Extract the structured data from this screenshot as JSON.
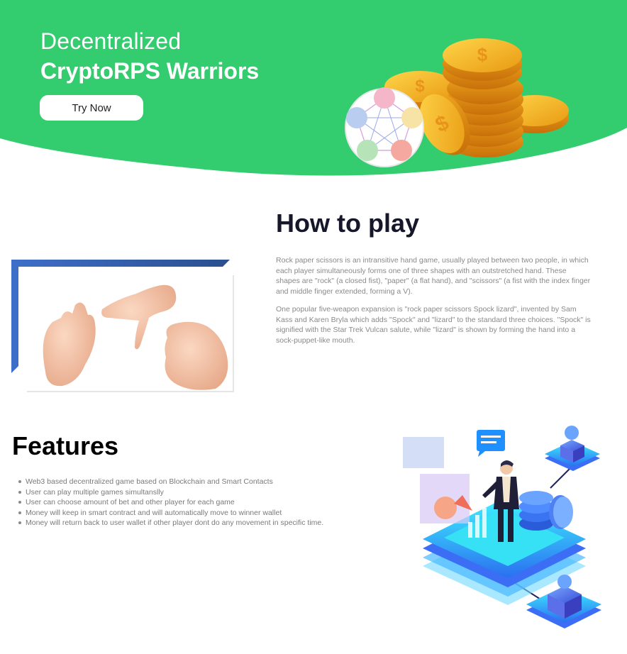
{
  "hero": {
    "subtitle": "Decentralized",
    "title": "CryptoRPS Warriors",
    "cta_label": "Try Now",
    "bg_color": "#33cc6f"
  },
  "how_to_play": {
    "title": "How to play",
    "paragraphs": [
      "Rock paper scissors is an intransitive hand game, usually played between two people, in which each player simultaneously forms one of three shapes with an outstretched hand. These shapes are \"rock\" (a closed fist), \"paper\" (a flat hand), and \"scissors\" (a fist with the index finger and middle finger extended, forming a V).",
      "One popular five-weapon expansion is \"rock paper scissors Spock lizard\", invented by Sam Kass and Karen Bryla which adds \"Spock\" and \"lizard\" to the standard three choices. \"Spock\" is signified with the Star Trek Vulcan salute, while \"lizard\" is shown by forming the hand into a sock-puppet-like mouth."
    ]
  },
  "features": {
    "title": "Features",
    "items": [
      "Web3 based decentralized game based on Blockchain and Smart Contacts",
      "User can play multiple games simultanslly",
      "User can choose amount of bet and other player for each game",
      "Money will keep in smart contract and will automatically move to winner wallet",
      "Money will return back to user wallet if other player dont do any movement in specific time."
    ]
  },
  "icons": {
    "coins": "coin-stack-illustration",
    "rps": "rock-paper-scissors-lizard-spock-icon",
    "hands": "hands-photo",
    "platform": "isometric-blockchain-illustration"
  }
}
